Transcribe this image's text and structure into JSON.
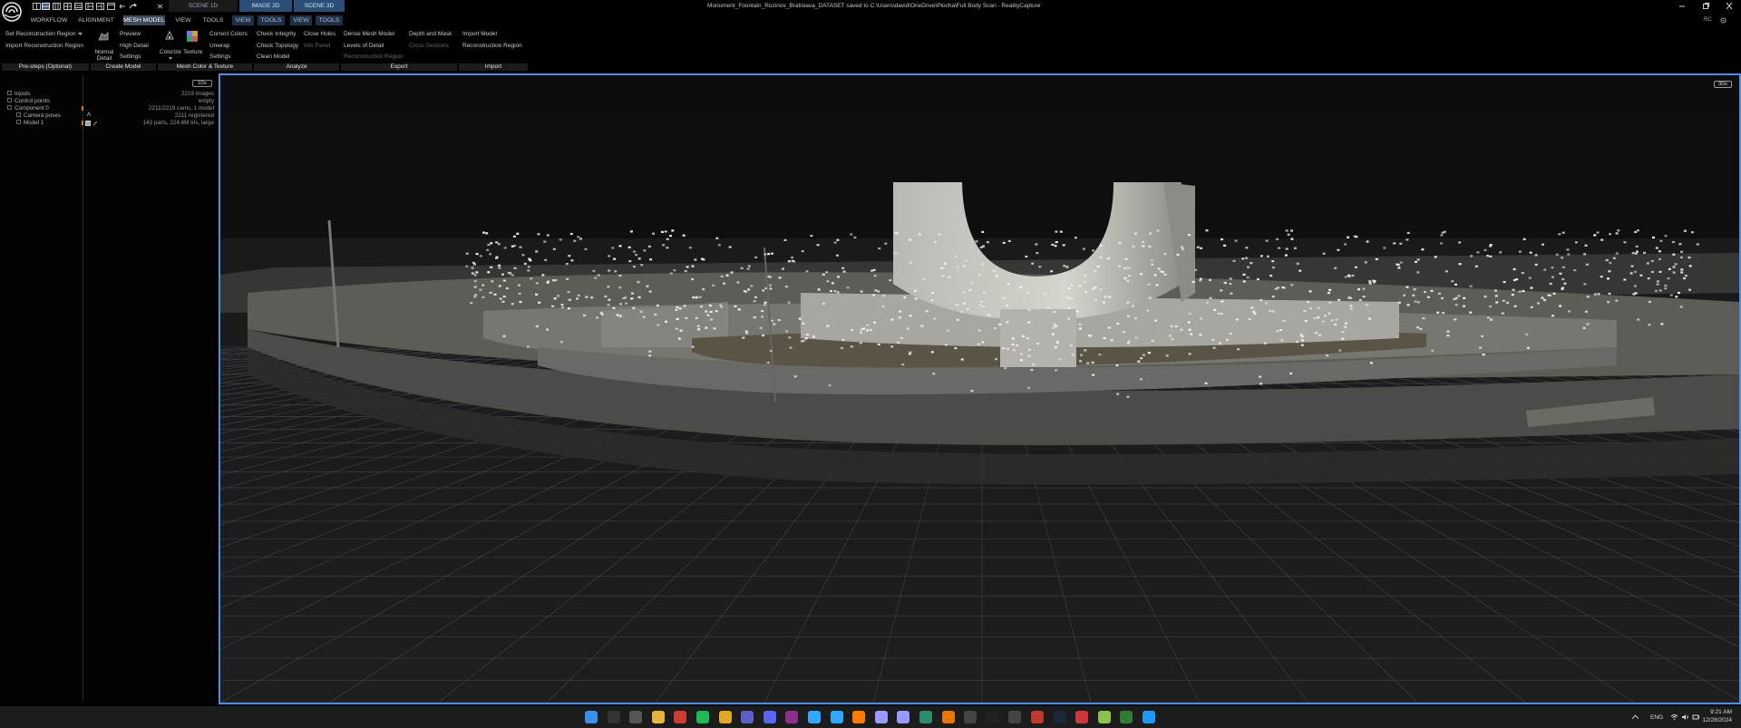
{
  "titlebar": {
    "tabs": [
      "SCENE 1D",
      "IMAGE 2D",
      "SCENE 3D"
    ],
    "window_title": "Monument_Fountain_Ruzinov_Bratislava_DATASET saved to C:\\Users\\david\\OneDrive\\Plocha\\Full Body Scan - RealityCapture"
  },
  "menubar": {
    "items": [
      "WORKFLOW",
      "ALIGNMENT",
      "MESH MODEL",
      "VIEW",
      "TOOLS"
    ],
    "context_items": [
      "VIEW",
      "TOOLS",
      "VIEW",
      "TOOLS"
    ],
    "badge": "RC"
  },
  "ribbon": {
    "prestep": {
      "set_region": "Set Reconstruction Region",
      "import_region": "Import Reconstruction Region",
      "label": "Pre-steps (Optional)"
    },
    "create": {
      "normal_detail": "Normal Detail",
      "preview": "Preview",
      "high_detail": "High Detail",
      "settings": "Settings",
      "label": "Create Model"
    },
    "color": {
      "colorize": "Colorize",
      "texture": "Texture",
      "correct_colors": "Correct Colors",
      "unwrap": "Unwrap",
      "settings": "Settings",
      "label": "Mesh Color & Texture"
    },
    "analyze": {
      "check_integrity": "Check Integrity",
      "close_holes": "Close Holes",
      "check_topology": "Check Topology",
      "info_panel": "Info Panel",
      "clean_model": "Clean Model",
      "label": "Analyze"
    },
    "export": {
      "decimate": "Dense Mesh Model",
      "depth_mask": "Depth and Mask",
      "levels_detail": "Levels of Detail",
      "cross_sections": "Cross Sections",
      "recon_region": "Reconstruction Region",
      "label": "Export"
    },
    "import": {
      "import_model": "Import Model",
      "recon_region": "Reconstruction Region",
      "label": "Import"
    }
  },
  "panel": {
    "badge": "1Ds",
    "tree": [
      {
        "label": "Inputs",
        "value": "2219 images"
      },
      {
        "label": "Control points",
        "value": "empty"
      },
      {
        "label": "Component 0",
        "value": "2211/2219 cams, 1 model"
      },
      {
        "label": "Camera poses",
        "value": "2211 registered"
      },
      {
        "label": "Model 1",
        "value": "143 parts, 224.6M tris, large"
      }
    ]
  },
  "viewport": {
    "badge": "3Ds"
  },
  "taskbar": {
    "lang": "ENG",
    "time": "9:21 AM",
    "date": "12/28/2024",
    "icons": [
      "windows-start-icon",
      "search-icon",
      "task-view-icon",
      "file-explorer-icon",
      "chrome-red-icon",
      "spotify-icon",
      "chrome-icon",
      "teams-icon",
      "discord-icon",
      "winrar-icon",
      "photoshop-icon",
      "lightroom-icon",
      "illustrator-icon",
      "premiere-icon",
      "after-effects-icon",
      "affinity-icon",
      "blender-icon",
      "github-icon",
      "unreal-icon",
      "epic-icon",
      "mixer-icon",
      "steam-icon",
      "riot-icon",
      "shield-icon",
      "flag-icon",
      "safari-icon"
    ]
  }
}
